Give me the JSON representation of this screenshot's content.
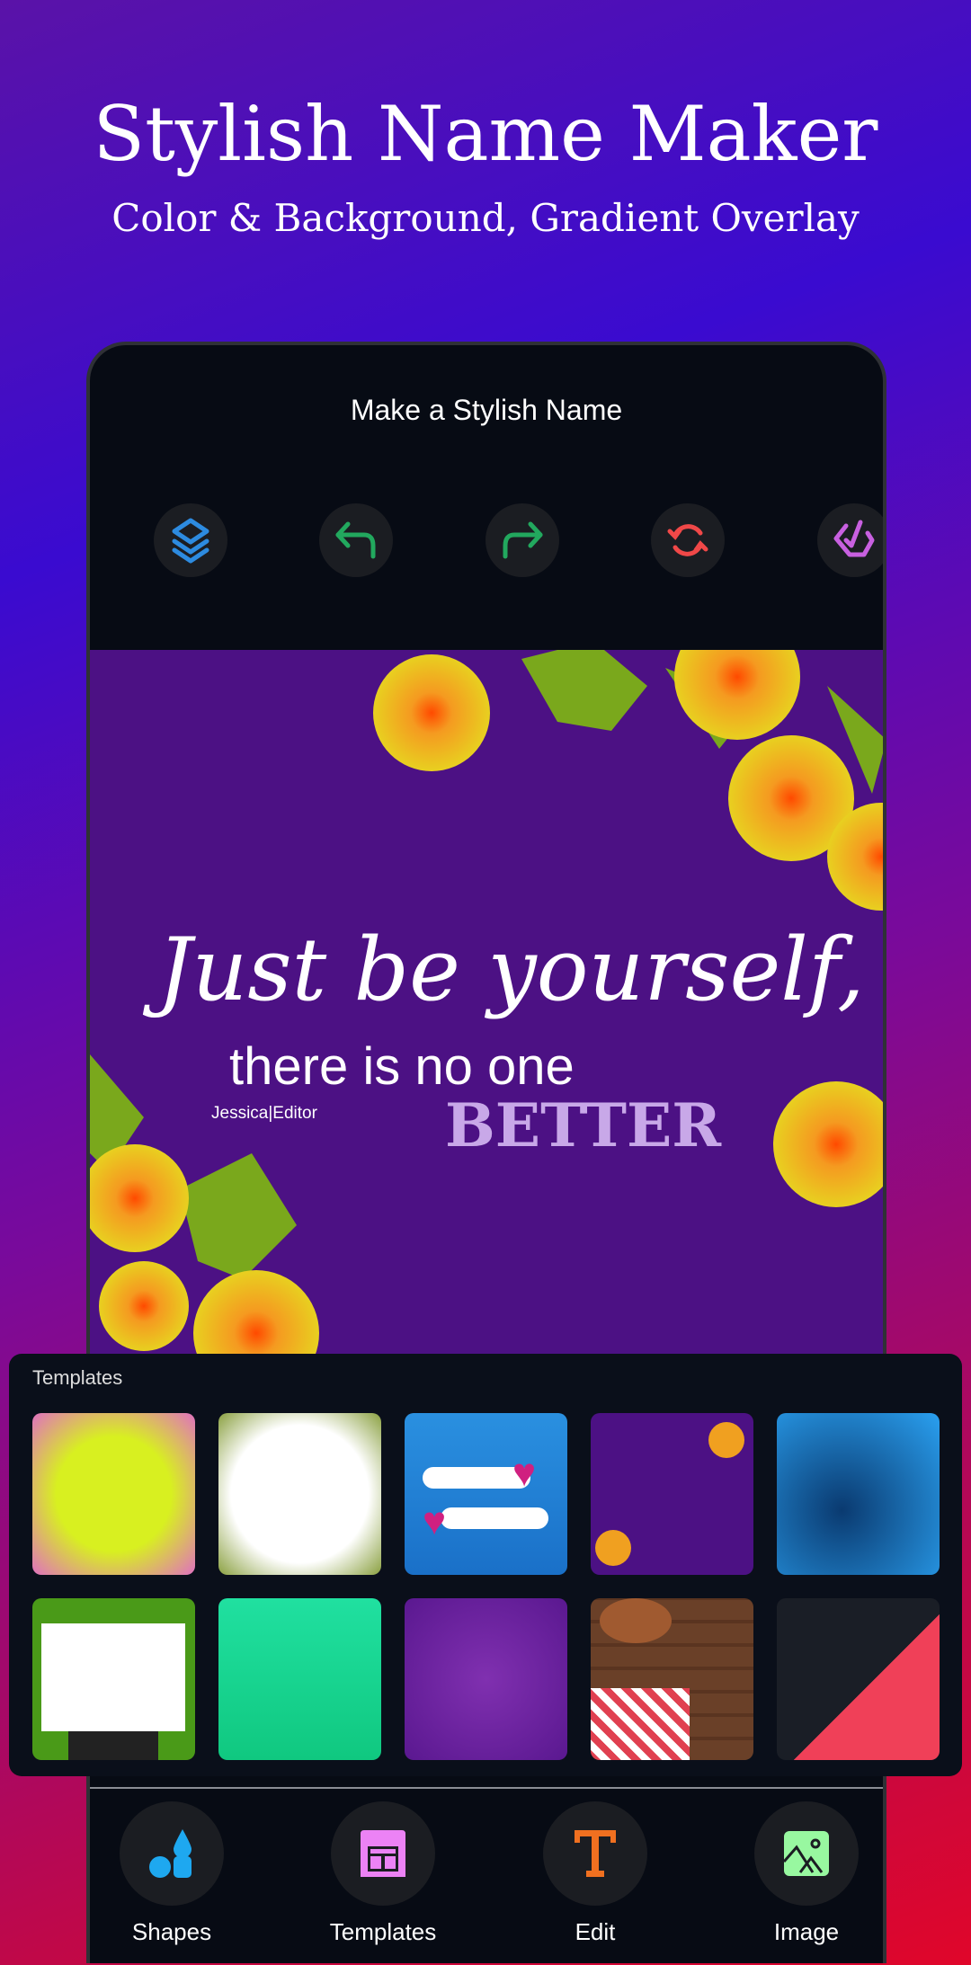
{
  "header": {
    "title": "Stylish Name Maker",
    "subtitle": "Color & Background, Gradient Overlay"
  },
  "app": {
    "title": "Make a Stylish Name",
    "toolbar": [
      {
        "icon": "layers-icon",
        "color": "#2d8be0"
      },
      {
        "icon": "undo-icon",
        "color": "#22a85e"
      },
      {
        "icon": "redo-icon",
        "color": "#22a85e"
      },
      {
        "icon": "refresh-icon",
        "color": "#f04848"
      },
      {
        "icon": "check-badge-icon",
        "color": "#c860e0"
      }
    ],
    "canvas": {
      "line1": "Just be yourself,",
      "line2": "there is no one",
      "line3": "BETTER",
      "signature": "Jessica|Editor"
    },
    "templates": {
      "label": "Templates",
      "count": 10
    },
    "nav": [
      {
        "label": "Shapes",
        "icon": "shapes-icon",
        "color": "#1ea8f0"
      },
      {
        "label": "Templates",
        "icon": "templates-icon",
        "color": "#ec82f5"
      },
      {
        "label": "Edit",
        "icon": "text-icon",
        "color": "#f07020"
      },
      {
        "label": "Image",
        "icon": "image-icon",
        "color": "#98f8a0"
      }
    ]
  }
}
